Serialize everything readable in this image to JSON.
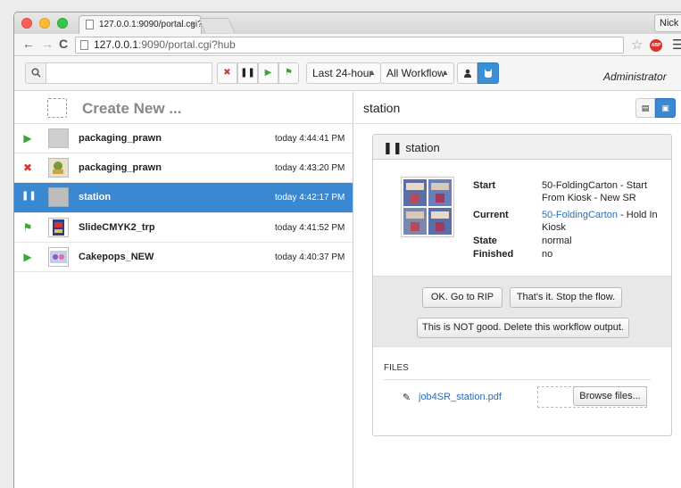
{
  "browser": {
    "tab_title": "127.0.0.1:9090/portal.cgi?",
    "tab_close": "×",
    "url_host": "127.0.0.1",
    "url_rest": ":9090/portal.cgi?hub",
    "user_button": "Nick",
    "abp_label": "ABP"
  },
  "toolbar": {
    "search_value": "",
    "time_filter": "Last 24-hour",
    "workflow_filter": "All Workflow",
    "user_label": "Administrator"
  },
  "sidebar": {
    "create_label": "Create New ...",
    "jobs": [
      {
        "status": "running",
        "status_glyph": "▶",
        "status_color": "#3aa63a",
        "name": "packaging_prawn",
        "time": "today 4:44:41 PM"
      },
      {
        "status": "error",
        "status_glyph": "✖",
        "status_color": "#d9342b",
        "name": "packaging_prawn",
        "time": "today 4:43:20 PM"
      },
      {
        "status": "paused",
        "status_glyph": "❚❚",
        "status_color": "#ffffff",
        "name": "station",
        "time": "today 4:42:17 PM"
      },
      {
        "status": "flagged",
        "status_glyph": "⚑",
        "status_color": "#3aa63a",
        "name": "SlideCMYK2_trp",
        "time": "today 4:41:52 PM"
      },
      {
        "status": "running",
        "status_glyph": "▶",
        "status_color": "#3aa63a",
        "name": "Cakepops_NEW",
        "time": "today 4:40:37 PM"
      }
    ]
  },
  "detail": {
    "header_title": "station",
    "panel_title": "station",
    "fields": {
      "start_label": "Start",
      "start_value": "50-FoldingCarton - Start From Kiosk - New SR",
      "current_label": "Current",
      "current_link": "50-FoldingCarton",
      "current_rest": " - Hold In Kiosk",
      "state_label": "State",
      "state_value": "normal",
      "finished_label": "Finished",
      "finished_value": "no"
    },
    "actions": {
      "ok": "OK. Go to RIP",
      "stop": "That's it. Stop the flow.",
      "delete": "This is NOT good. Delete this workflow output."
    },
    "files": {
      "label": "FILES",
      "file_name": "job4SR_station.pdf",
      "browse": "Browse files..."
    }
  },
  "colors": {
    "accent": "#3a87d2",
    "link": "#2a6ebb",
    "play_green": "#3aa63a",
    "error_red": "#d9342b"
  }
}
